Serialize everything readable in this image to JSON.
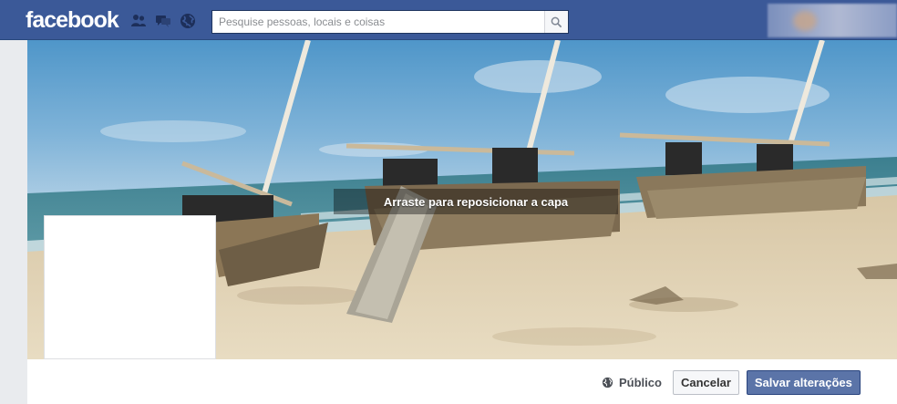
{
  "header": {
    "logo": "facebook",
    "search_placeholder": "Pesquise pessoas, locais e coisas"
  },
  "icons": {
    "friends": "friend-requests-icon",
    "messages": "messages-icon",
    "notifications": "globe-notifications-icon",
    "search": "magnifier-icon",
    "privacy": "globe-icon"
  },
  "cover": {
    "hint": "Arraste para reposicionar a capa"
  },
  "actions": {
    "privacy_label": "Público",
    "cancel_label": "Cancelar",
    "save_label": "Salvar alterações"
  },
  "colors": {
    "brand": "#3b5998",
    "save_button": "#5b74a8"
  }
}
